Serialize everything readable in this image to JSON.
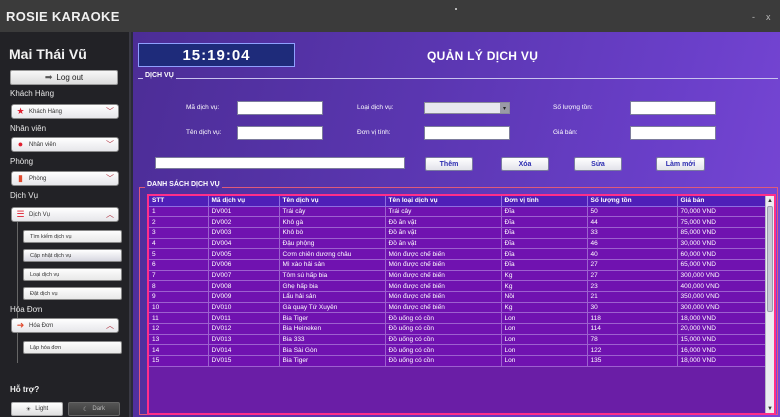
{
  "window": {
    "title": "ROSIE KARAOKE",
    "minimize": "-",
    "close": "x"
  },
  "sidebar": {
    "user_name": "Mai Thái Vũ",
    "logout_label": "Log out",
    "sections": {
      "customer": {
        "label": "Khách Hàng",
        "combo": "Khách Hàng"
      },
      "staff": {
        "label": "Nhân viên",
        "combo": "Nhân viên"
      },
      "room": {
        "label": "Phòng",
        "combo": "Phòng"
      },
      "service": {
        "label": "Dịch Vụ",
        "combo": "Dịch Vụ",
        "items": [
          "Tìm kiếm dịch vụ",
          "Cập nhật dịch vụ",
          "Loại dịch vụ",
          "Đặt dịch vụ"
        ]
      },
      "invoice": {
        "label": "Hóa Đơn",
        "combo": "Hóa Đơn",
        "items": [
          "Lập hóa đơn"
        ]
      }
    },
    "help_label": "Hỗ trợ?",
    "light_label": "Light",
    "dark_label": "Dark"
  },
  "main": {
    "clock": "15:19:04",
    "title": "QUẢN LÝ DỊCH VỤ",
    "form_legend": "DỊCH VỤ",
    "form": {
      "ma_dich_vu_label": "Mã dịch vụ:",
      "ten_dich_vu_label": "Tên dịch vụ:",
      "loai_dich_vu_label": "Loại dịch vụ:",
      "don_vi_tinh_label": "Đơn vị tính:",
      "so_luong_ton_label": "Số lượng tồn:",
      "gia_ban_label": "Giá bán:"
    },
    "buttons": {
      "add": "Thêm",
      "delete": "Xóa",
      "edit": "Sửa",
      "refresh": "Làm mới"
    },
    "list_legend": "DANH SÁCH DỊCH VỤ",
    "table": {
      "headers": [
        "STT",
        "Mã dịch vụ",
        "Tên dịch vụ",
        "Tên loại dịch vụ",
        "Đơn vị tính",
        "Số lượng tồn",
        "Giá bán"
      ],
      "rows": [
        [
          "1",
          "DV001",
          "Trái cây",
          "Trái cây",
          "Đĩa",
          "50",
          "70,000 VND"
        ],
        [
          "2",
          "DV002",
          "Khô gà",
          "Đồ ăn vặt",
          "Đĩa",
          "44",
          "75,000 VND"
        ],
        [
          "3",
          "DV003",
          "Khô bò",
          "Đồ ăn vặt",
          "Đĩa",
          "33",
          "85,000 VND"
        ],
        [
          "4",
          "DV004",
          "Đậu phộng",
          "Đồ ăn vặt",
          "Đĩa",
          "46",
          "30,000 VND"
        ],
        [
          "5",
          "DV005",
          "Cơm chiên dương châu",
          "Món được chế biến",
          "Đĩa",
          "40",
          "60,000 VND"
        ],
        [
          "6",
          "DV006",
          "Mì xào hải sản",
          "Món được chế biến",
          "Đĩa",
          "27",
          "65,000 VND"
        ],
        [
          "7",
          "DV007",
          "Tôm sú hấp bia",
          "Món được chế biến",
          "Kg",
          "27",
          "300,000 VND"
        ],
        [
          "8",
          "DV008",
          "Ghẹ hấp bia",
          "Món được chế biến",
          "Kg",
          "23",
          "400,000 VND"
        ],
        [
          "9",
          "DV009",
          "Lẩu hải sản",
          "Món được chế biến",
          "Nồi",
          "21",
          "350,000 VND"
        ],
        [
          "10",
          "DV010",
          "Gà quay Tứ Xuyên",
          "Món được chế biến",
          "Kg",
          "30",
          "300,000 VND"
        ],
        [
          "11",
          "DV011",
          "Bia Tiger",
          "Đồ uống có cồn",
          "Lon",
          "118",
          "18,000 VND"
        ],
        [
          "12",
          "DV012",
          "Bia Heineken",
          "Đồ uống có cồn",
          "Lon",
          "114",
          "20,000 VND"
        ],
        [
          "13",
          "DV013",
          "Bia 333",
          "Đồ uống có cồn",
          "Lon",
          "78",
          "15,000 VND"
        ],
        [
          "14",
          "DV014",
          "Bia Sài Gòn",
          "Đồ uống có cồn",
          "Lon",
          "122",
          "16,000 VND"
        ],
        [
          "15",
          "DV015",
          "Bia Tiger",
          "Đồ uống có cồn",
          "Lon",
          "135",
          "18,000 VND"
        ]
      ]
    }
  },
  "colors": {
    "main_bg": "#5a36b0",
    "row_bg": "#7012b0",
    "table_border": "#ff2e8a",
    "clock_bg": "#1e2b7a"
  }
}
